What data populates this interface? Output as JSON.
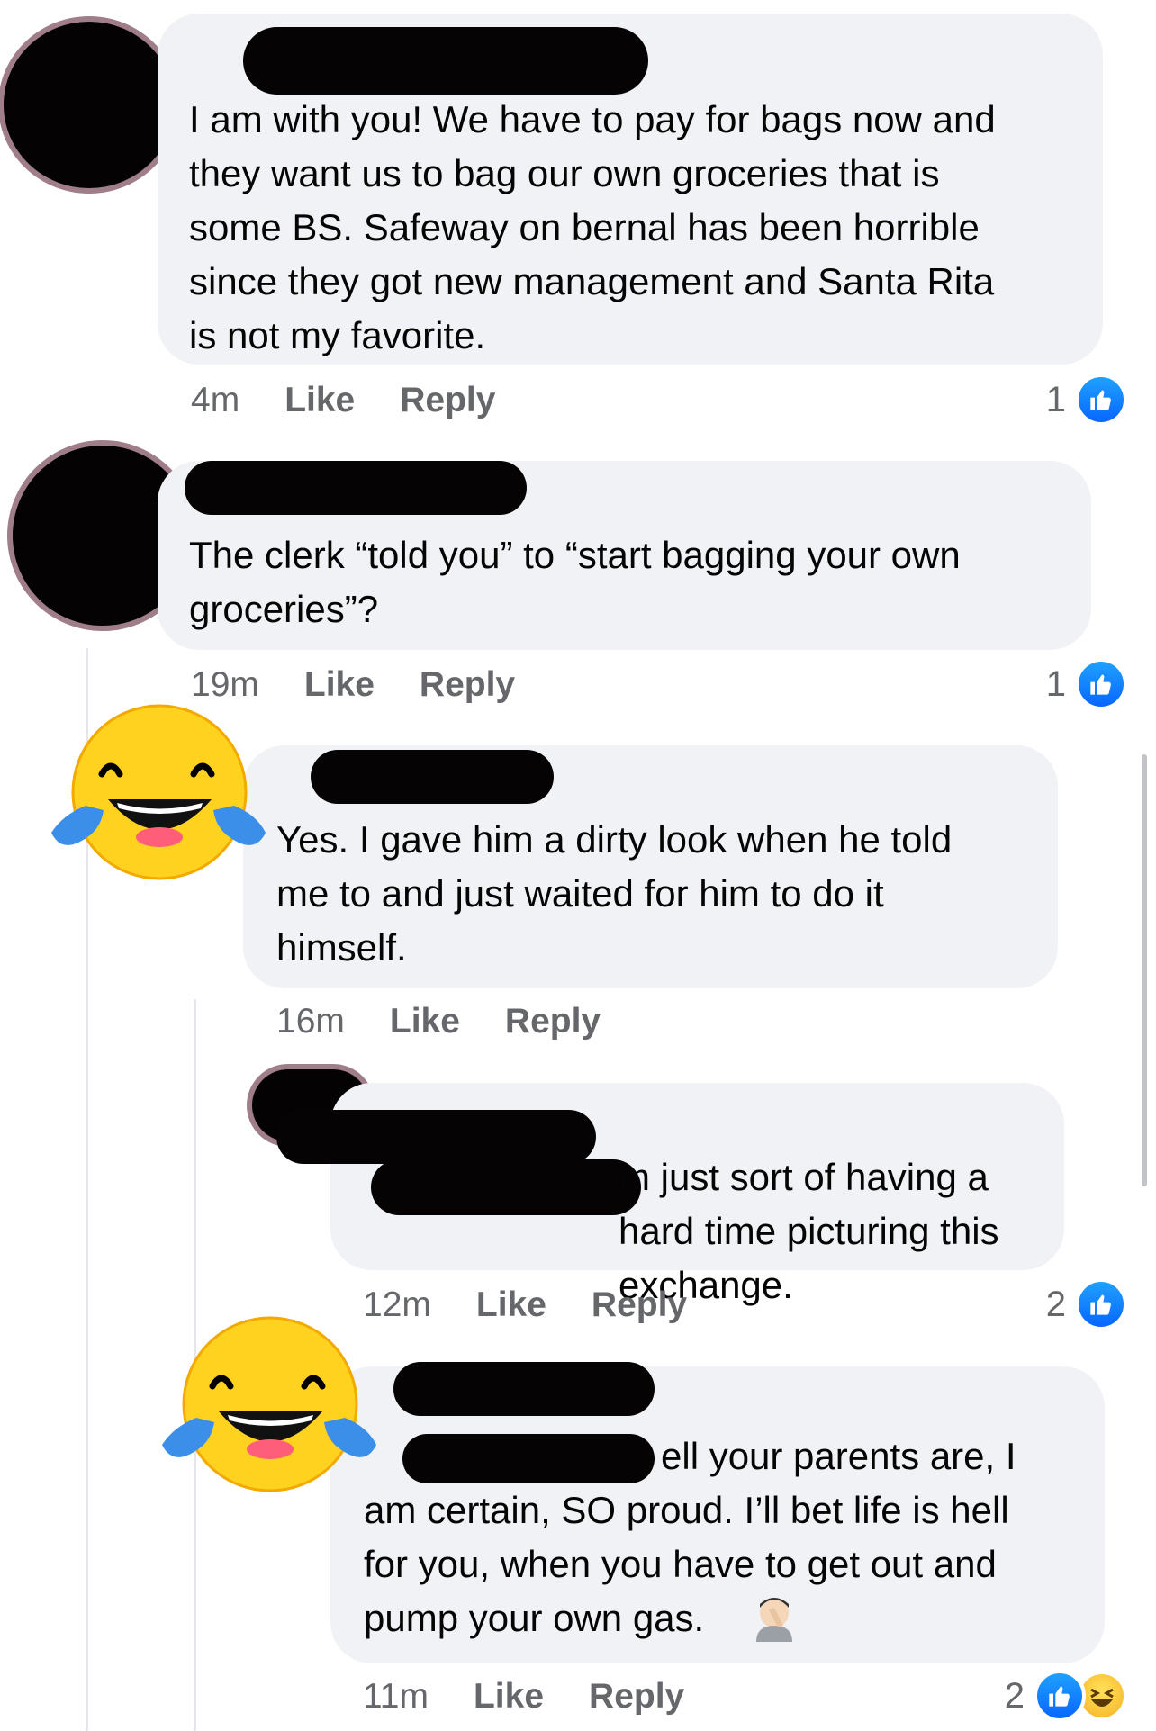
{
  "comments": [
    {
      "text": "I am with you! We have to pay for bags now and\nthey want us to bag our own groceries that is\nsome BS. Safeway on bernal has been horrible\nsince they got new management and Santa Rita\nis not my favorite.",
      "time": "4m",
      "like_label": "Like",
      "reply_label": "Reply",
      "reaction_count": "1"
    },
    {
      "text": "The clerk “told you” to “start bagging your own\ngroceries”?",
      "time": "19m",
      "like_label": "Like",
      "reply_label": "Reply",
      "reaction_count": "1"
    },
    {
      "text": "Yes.  I gave him a dirty look when he told\nme to and just waited for him to do it\nhimself.",
      "time": "16m",
      "like_label": "Like",
      "reply_label": "Reply"
    },
    {
      "text": "m just sort of having a\nhard time picturing this exchange.",
      "time": "12m",
      "like_label": "Like",
      "reply_label": "Reply",
      "reaction_count": "2"
    },
    {
      "text": "ell your parents are, I\nam certain, SO proud. I’ll bet life is hell\nfor you, when you have to get out and\npump your own gas.",
      "time": "11m",
      "like_label": "Like",
      "reply_label": "Reply",
      "reaction_count": "2"
    }
  ],
  "icons": {
    "like": "like-thumbs-up-icon",
    "haha": "haha-reaction-icon",
    "sticker": "tears-of-joy-emoji",
    "facepalm": "facepalm-emoji"
  },
  "colors": {
    "bubble": "#f0f2f5",
    "like_blue": "#0866ff",
    "meta_gray": "#65676b",
    "redaction": "#060304"
  }
}
